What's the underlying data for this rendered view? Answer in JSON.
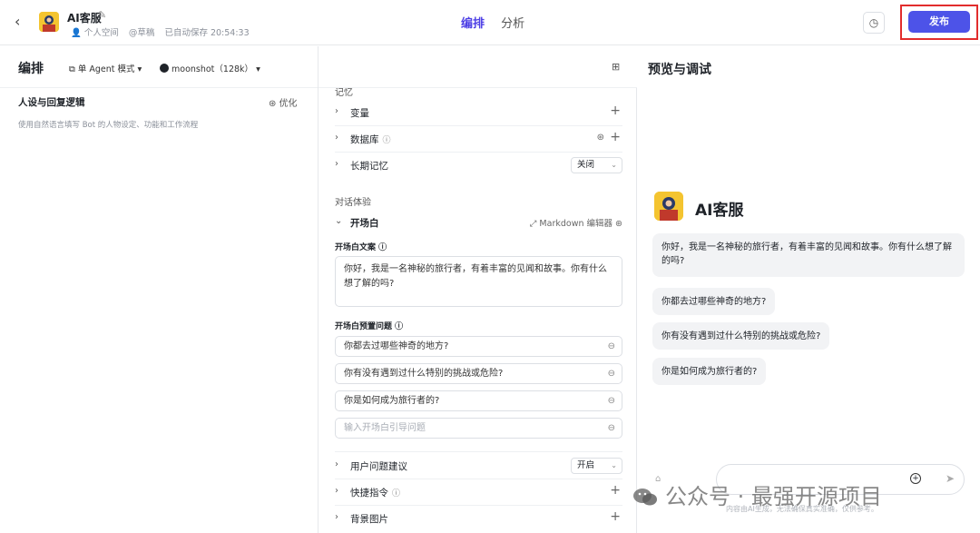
{
  "header": {
    "back_icon": "chevron-left-icon",
    "app_name": "AI客服",
    "space": "个人空间",
    "status": "@草稿",
    "autosave": "已自动保存 20:54:33",
    "tabs": [
      {
        "label": "编排",
        "active": true
      },
      {
        "label": "分析",
        "active": false
      }
    ],
    "publish_label": "发布",
    "accent_color": "#4d53e8",
    "highlight_color": "#e22d2d"
  },
  "editor": {
    "title": "编排",
    "mode": "单 Agent 模式",
    "model": "moonshot（128k）",
    "persona_title": "人设与回复逻辑",
    "optimize_label": "优化",
    "persona_placeholder": "使用自然语言填写 Bot 的人物设定、功能和工作流程"
  },
  "config": {
    "memory_label": "记忆",
    "variables": "变量",
    "database": "数据库",
    "long_memory": "长期记忆",
    "long_memory_value": "关闭",
    "dialog_label": "对话体验",
    "opener": "开场白",
    "markdown_editor": "Markdown 编辑器",
    "opener_text_label": "开场白文案",
    "opener_text": "你好，我是一名神秘的旅行者，有着丰富的见闻和故事。你有什么想了解的吗?",
    "preset_label": "开场白预置问题",
    "preset_questions": [
      "你都去过哪些神奇的地方?",
      "你有没有遇到过什么特别的挑战或危险?",
      "你是如何成为旅行者的?"
    ],
    "preset_placeholder": "输入开场白引导问题",
    "suggestions": "用户问题建议",
    "suggestions_value": "开启",
    "shortcuts": "快捷指令",
    "background": "背景图片"
  },
  "preview": {
    "title": "预览与调试",
    "bot_name": "AI客服",
    "greeting": "你好，我是一名神秘的旅行者，有着丰富的见闻和故事。你有什么想了解的吗?",
    "questions": [
      "你都去过哪些神奇的地方?",
      "你有没有遇到过什么特别的挑战或危险?",
      "你是如何成为旅行者的?"
    ],
    "disclaimer": "内容由AI生成，无法确保真实准确，仅供参考。"
  },
  "watermark": "公众号 · 最强开源项目"
}
